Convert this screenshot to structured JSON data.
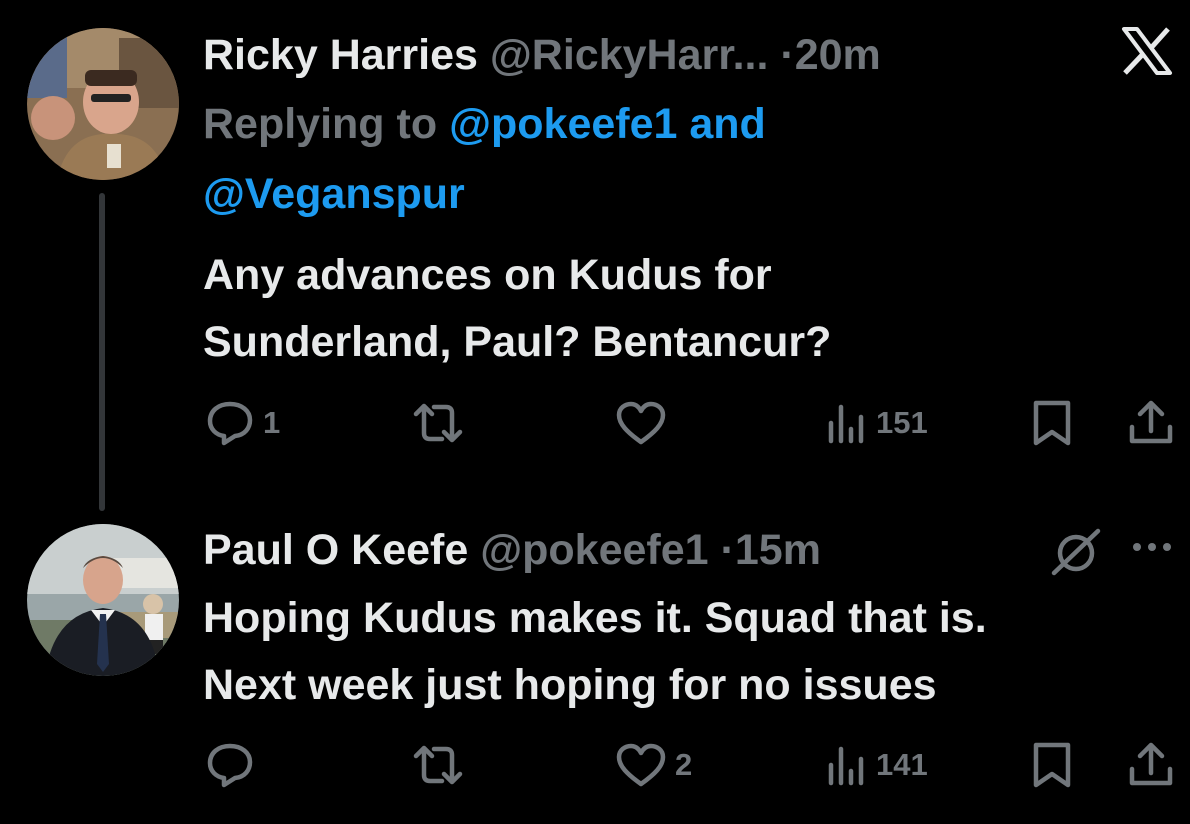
{
  "tweets": [
    {
      "author_name": "Ricky Harries",
      "handle": "@RickyHarr...",
      "separator": "·",
      "time": "20m",
      "replying_prefix": "Replying to",
      "reply_mention_1": "@pokeefe1",
      "reply_and": "and",
      "reply_mention_2": "@Veganspur",
      "text": "Any advances on Kudus for\nSunderland, Paul? Bentancur?",
      "reply_count": "1",
      "retweet_count": "",
      "like_count": "",
      "view_count": "151"
    },
    {
      "author_name": "Paul O Keefe",
      "handle": "@pokeefe1",
      "separator": "·",
      "time": "15m",
      "text": "Hoping Kudus makes it. Squad that is.\nNext week just hoping for no issues",
      "reply_count": "",
      "retweet_count": "",
      "like_count": "2",
      "view_count": "141"
    }
  ],
  "icons": {
    "close": "x-logo-icon",
    "grok": "grok-icon",
    "more": "more-icon",
    "reply": "reply-icon",
    "retweet": "retweet-icon",
    "like": "like-icon",
    "views": "views-icon",
    "bookmark": "bookmark-icon",
    "share": "share-icon"
  },
  "colors": {
    "background": "#000000",
    "text": "#e7e9ea",
    "secondary": "#71767b",
    "link": "#1d9bf0"
  }
}
